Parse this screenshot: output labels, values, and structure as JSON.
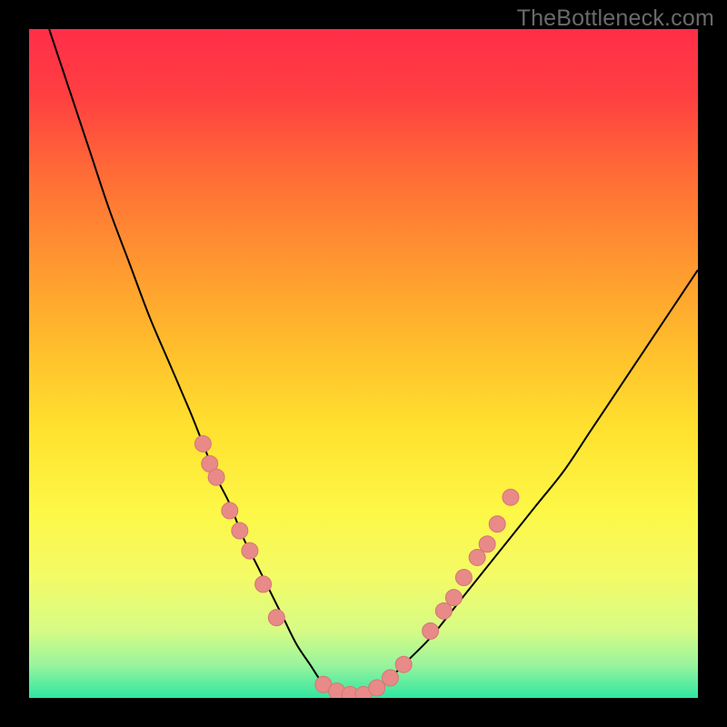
{
  "watermark": "TheBottleneck.com",
  "colors": {
    "frame": "#000000",
    "curve": "#000000",
    "dot_fill": "#e78a88",
    "dot_stroke": "#d87573",
    "gradient_stops": [
      {
        "offset": 0.0,
        "color": "#ff2e49"
      },
      {
        "offset": 0.1,
        "color": "#ff3f41"
      },
      {
        "offset": 0.22,
        "color": "#ff6d36"
      },
      {
        "offset": 0.35,
        "color": "#ff9730"
      },
      {
        "offset": 0.48,
        "color": "#ffbf2c"
      },
      {
        "offset": 0.6,
        "color": "#ffe22f"
      },
      {
        "offset": 0.72,
        "color": "#fdf746"
      },
      {
        "offset": 0.82,
        "color": "#f3fb67"
      },
      {
        "offset": 0.9,
        "color": "#d6fb85"
      },
      {
        "offset": 0.95,
        "color": "#9af49d"
      },
      {
        "offset": 1.0,
        "color": "#2fe6a1"
      }
    ]
  },
  "chart_data": {
    "type": "line",
    "title": "",
    "xlabel": "",
    "ylabel": "",
    "xlim": [
      0,
      100
    ],
    "ylim": [
      0,
      100
    ],
    "notes": "V-shaped bottleneck curve over rainbow vertical gradient. Curve value ≈ bottleneck % (0 at valley). Salmon dots mark sampled configurations on the curve.",
    "series": [
      {
        "name": "bottleneck-curve",
        "x": [
          3,
          6,
          9,
          12,
          15,
          18,
          21,
          24,
          26,
          28,
          30,
          32,
          34,
          36,
          38,
          40,
          42,
          44,
          46,
          48,
          50,
          53,
          56,
          60,
          64,
          68,
          72,
          76,
          80,
          84,
          88,
          92,
          96,
          100
        ],
        "y": [
          100,
          91,
          82,
          73,
          65,
          57,
          50,
          43,
          38,
          33,
          29,
          24,
          20,
          16,
          12,
          8,
          5,
          2,
          0,
          0,
          0,
          2,
          5,
          9,
          14,
          19,
          24,
          29,
          34,
          40,
          46,
          52,
          58,
          64
        ]
      }
    ],
    "dots": [
      {
        "x": 26,
        "y": 38
      },
      {
        "x": 27,
        "y": 35
      },
      {
        "x": 28,
        "y": 33
      },
      {
        "x": 30,
        "y": 28
      },
      {
        "x": 31.5,
        "y": 25
      },
      {
        "x": 33,
        "y": 22
      },
      {
        "x": 35,
        "y": 17
      },
      {
        "x": 37,
        "y": 12
      },
      {
        "x": 44,
        "y": 2
      },
      {
        "x": 46,
        "y": 1
      },
      {
        "x": 48,
        "y": 0.5
      },
      {
        "x": 50,
        "y": 0.5
      },
      {
        "x": 52,
        "y": 1.5
      },
      {
        "x": 54,
        "y": 3
      },
      {
        "x": 56,
        "y": 5
      },
      {
        "x": 60,
        "y": 10
      },
      {
        "x": 62,
        "y": 13
      },
      {
        "x": 63.5,
        "y": 15
      },
      {
        "x": 65,
        "y": 18
      },
      {
        "x": 67,
        "y": 21
      },
      {
        "x": 68.5,
        "y": 23
      },
      {
        "x": 70,
        "y": 26
      },
      {
        "x": 72,
        "y": 30
      }
    ]
  }
}
